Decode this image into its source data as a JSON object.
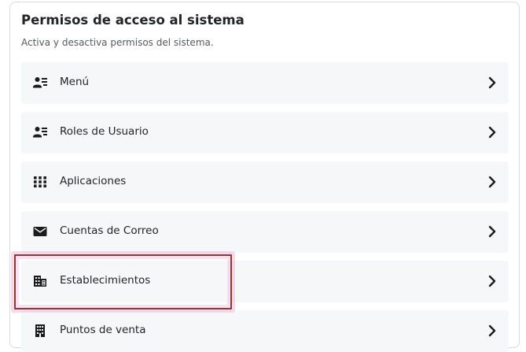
{
  "panel": {
    "title": "Permisos de acceso al sistema",
    "subtitle": "Activa y desactiva permisos del sistema."
  },
  "items": [
    {
      "label": "Menú",
      "icon": "user-list-icon"
    },
    {
      "label": "Roles de Usuario",
      "icon": "user-list-icon"
    },
    {
      "label": "Aplicaciones",
      "icon": "apps-grid-icon"
    },
    {
      "label": "Cuentas de Correo",
      "icon": "envelope-icon"
    },
    {
      "label": "Establecimientos",
      "icon": "building-icon"
    },
    {
      "label": "Puntos de venta",
      "icon": "store-building-icon"
    }
  ],
  "highlighted_item": "Establecimientos",
  "colors": {
    "item_background": "#f6f7f8",
    "text": "#222428",
    "highlight_border": "#8b3a2c"
  }
}
